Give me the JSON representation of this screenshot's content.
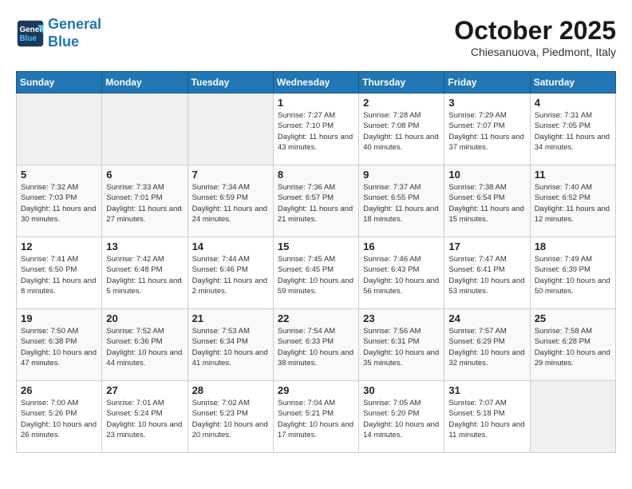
{
  "logo": {
    "line1": "General",
    "line2": "Blue"
  },
  "title": "October 2025",
  "subtitle": "Chiesanuova, Piedmont, Italy",
  "days_of_week": [
    "Sunday",
    "Monday",
    "Tuesday",
    "Wednesday",
    "Thursday",
    "Friday",
    "Saturday"
  ],
  "weeks": [
    [
      {
        "num": "",
        "info": ""
      },
      {
        "num": "",
        "info": ""
      },
      {
        "num": "",
        "info": ""
      },
      {
        "num": "1",
        "info": "Sunrise: 7:27 AM\nSunset: 7:10 PM\nDaylight: 11 hours and 43 minutes."
      },
      {
        "num": "2",
        "info": "Sunrise: 7:28 AM\nSunset: 7:08 PM\nDaylight: 11 hours and 40 minutes."
      },
      {
        "num": "3",
        "info": "Sunrise: 7:29 AM\nSunset: 7:07 PM\nDaylight: 11 hours and 37 minutes."
      },
      {
        "num": "4",
        "info": "Sunrise: 7:31 AM\nSunset: 7:05 PM\nDaylight: 11 hours and 34 minutes."
      }
    ],
    [
      {
        "num": "5",
        "info": "Sunrise: 7:32 AM\nSunset: 7:03 PM\nDaylight: 11 hours and 30 minutes."
      },
      {
        "num": "6",
        "info": "Sunrise: 7:33 AM\nSunset: 7:01 PM\nDaylight: 11 hours and 27 minutes."
      },
      {
        "num": "7",
        "info": "Sunrise: 7:34 AM\nSunset: 6:59 PM\nDaylight: 11 hours and 24 minutes."
      },
      {
        "num": "8",
        "info": "Sunrise: 7:36 AM\nSunset: 6:57 PM\nDaylight: 11 hours and 21 minutes."
      },
      {
        "num": "9",
        "info": "Sunrise: 7:37 AM\nSunset: 6:55 PM\nDaylight: 11 hours and 18 minutes."
      },
      {
        "num": "10",
        "info": "Sunrise: 7:38 AM\nSunset: 6:54 PM\nDaylight: 11 hours and 15 minutes."
      },
      {
        "num": "11",
        "info": "Sunrise: 7:40 AM\nSunset: 6:52 PM\nDaylight: 11 hours and 12 minutes."
      }
    ],
    [
      {
        "num": "12",
        "info": "Sunrise: 7:41 AM\nSunset: 6:50 PM\nDaylight: 11 hours and 8 minutes."
      },
      {
        "num": "13",
        "info": "Sunrise: 7:42 AM\nSunset: 6:48 PM\nDaylight: 11 hours and 5 minutes."
      },
      {
        "num": "14",
        "info": "Sunrise: 7:44 AM\nSunset: 6:46 PM\nDaylight: 11 hours and 2 minutes."
      },
      {
        "num": "15",
        "info": "Sunrise: 7:45 AM\nSunset: 6:45 PM\nDaylight: 10 hours and 59 minutes."
      },
      {
        "num": "16",
        "info": "Sunrise: 7:46 AM\nSunset: 6:43 PM\nDaylight: 10 hours and 56 minutes."
      },
      {
        "num": "17",
        "info": "Sunrise: 7:47 AM\nSunset: 6:41 PM\nDaylight: 10 hours and 53 minutes."
      },
      {
        "num": "18",
        "info": "Sunrise: 7:49 AM\nSunset: 6:39 PM\nDaylight: 10 hours and 50 minutes."
      }
    ],
    [
      {
        "num": "19",
        "info": "Sunrise: 7:50 AM\nSunset: 6:38 PM\nDaylight: 10 hours and 47 minutes."
      },
      {
        "num": "20",
        "info": "Sunrise: 7:52 AM\nSunset: 6:36 PM\nDaylight: 10 hours and 44 minutes."
      },
      {
        "num": "21",
        "info": "Sunrise: 7:53 AM\nSunset: 6:34 PM\nDaylight: 10 hours and 41 minutes."
      },
      {
        "num": "22",
        "info": "Sunrise: 7:54 AM\nSunset: 6:33 PM\nDaylight: 10 hours and 38 minutes."
      },
      {
        "num": "23",
        "info": "Sunrise: 7:56 AM\nSunset: 6:31 PM\nDaylight: 10 hours and 35 minutes."
      },
      {
        "num": "24",
        "info": "Sunrise: 7:57 AM\nSunset: 6:29 PM\nDaylight: 10 hours and 32 minutes."
      },
      {
        "num": "25",
        "info": "Sunrise: 7:58 AM\nSunset: 6:28 PM\nDaylight: 10 hours and 29 minutes."
      }
    ],
    [
      {
        "num": "26",
        "info": "Sunrise: 7:00 AM\nSunset: 5:26 PM\nDaylight: 10 hours and 26 minutes."
      },
      {
        "num": "27",
        "info": "Sunrise: 7:01 AM\nSunset: 5:24 PM\nDaylight: 10 hours and 23 minutes."
      },
      {
        "num": "28",
        "info": "Sunrise: 7:02 AM\nSunset: 5:23 PM\nDaylight: 10 hours and 20 minutes."
      },
      {
        "num": "29",
        "info": "Sunrise: 7:04 AM\nSunset: 5:21 PM\nDaylight: 10 hours and 17 minutes."
      },
      {
        "num": "30",
        "info": "Sunrise: 7:05 AM\nSunset: 5:20 PM\nDaylight: 10 hours and 14 minutes."
      },
      {
        "num": "31",
        "info": "Sunrise: 7:07 AM\nSunset: 5:18 PM\nDaylight: 10 hours and 11 minutes."
      },
      {
        "num": "",
        "info": ""
      }
    ]
  ]
}
